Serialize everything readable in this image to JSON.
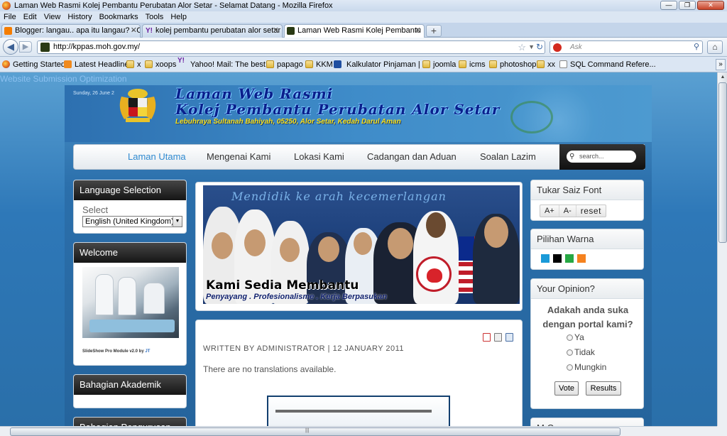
{
  "window": {
    "title": "Laman Web Rasmi Kolej Pembantu Perubatan Alor Setar - Selamat Datang - Mozilla Firefox"
  },
  "menu": [
    "File",
    "Edit",
    "View",
    "History",
    "Bookmarks",
    "Tools",
    "Help"
  ],
  "tabs": [
    {
      "label": "Blogger: langau.. apa itu langau? - Cr...",
      "icon": "blogger-icon",
      "color": "#f57d00"
    },
    {
      "label": "kolej pembantu perubatan alor setar ...",
      "icon": "yahoo-icon",
      "color": "#6b1fa0"
    },
    {
      "label": "Laman Web Rasmi Kolej Pembantu P...",
      "icon": "site-icon",
      "color": "#2a3a14"
    }
  ],
  "newtab_label": "+",
  "url": "http://kppas.moh.gov.my/",
  "search": {
    "placeholder": "Ask"
  },
  "bookmarks": [
    {
      "label": "Getting Started",
      "type": "ff"
    },
    {
      "label": "Latest Headlines",
      "type": "rss"
    },
    {
      "label": "x",
      "type": "folder"
    },
    {
      "label": "xoops",
      "type": "folder"
    },
    {
      "label": "Yahoo! Mail: The best ...",
      "type": "yahoo"
    },
    {
      "label": "papago",
      "type": "folder"
    },
    {
      "label": "KKM",
      "type": "folder"
    },
    {
      "label": "Kalkulator Pinjaman | ...",
      "type": "dict"
    },
    {
      "label": "joomla",
      "type": "folder"
    },
    {
      "label": "icms",
      "type": "folder"
    },
    {
      "label": "photoshop",
      "type": "folder"
    },
    {
      "label": "xx",
      "type": "folder"
    },
    {
      "label": "SQL Command Refere...",
      "type": "page"
    }
  ],
  "page": {
    "top_link": "Website Submission Optimization",
    "header": {
      "date": "Sunday, 26 June 2",
      "title_line1": "Laman Web Rasmi",
      "title_line2": "Kolej Pembantu Perubatan Alor Setar",
      "address": "Lebuhraya Sultanah Bahiyah, 05250, Alor Setar, Kedah Darul Aman"
    },
    "nav": [
      "Laman Utama",
      "Mengenai Kami",
      "Lokasi Kami",
      "Cadangan dan Aduan",
      "Soalan Lazim"
    ],
    "nav_search_placeholder": "search...",
    "left": {
      "language": {
        "title": "Language Selection",
        "label": "Select",
        "value": "English (United Kingdom)"
      },
      "welcome": {
        "title": "Welcome",
        "caption": "SlideShow Pro Module v2.0 by",
        "caption_author": "JT"
      },
      "akademik": {
        "title": "Bahagian Akademik"
      },
      "pengurusan": {
        "title": "Bahagian Pengurusan"
      }
    },
    "banner": {
      "motto": "Mendidik ke arah kecemerlangan",
      "title": "Kami Sedia Membantu",
      "subtitle": "Penyayang . Profesionalisme . Kerja Berpasukan"
    },
    "article": {
      "byline": "WRITTEN BY ADMINISTRATOR | 12 JANUARY 2011",
      "body": "There are no translations available."
    },
    "right": {
      "font": {
        "title": "Tukar Saiz Font",
        "inc": "A+",
        "dec": "A-",
        "reset": "reset"
      },
      "color": {
        "title": "Pilihan Warna",
        "swatches": [
          "#1a9ad8",
          "#000000",
          "#27a844",
          "#f5821f"
        ]
      },
      "poll": {
        "title": "Your Opinion?",
        "question": "Adakah anda suka dengan portal kami?",
        "options": [
          "Ya",
          "Tidak",
          "Mungkin"
        ],
        "vote": "Vote",
        "results": "Results"
      },
      "next_title": "M     C"
    }
  }
}
